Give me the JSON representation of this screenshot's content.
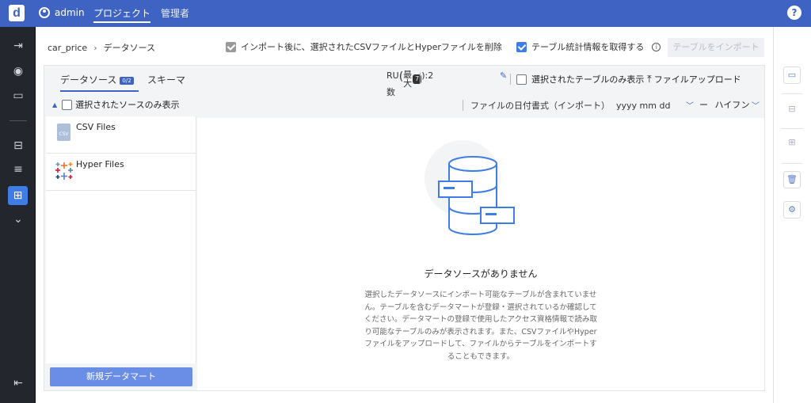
{
  "topbar": {
    "logo": "d",
    "user": "admin",
    "nav_active": "プロジェクト",
    "nav_admin": "管理者",
    "help": "?"
  },
  "breadcrumb": {
    "project": "car_price",
    "current": "データソース"
  },
  "options": {
    "delete_after_import": "インポート後に、選択されたCSVファイルとHyperファイルを削除",
    "get_stats": "テーブル統計情報を取得する",
    "import_button": "テーブルをインポート"
  },
  "tabs": {
    "datasource": "データソース",
    "badge": "0/2",
    "schema": "スキーマ"
  },
  "source_filter": "選択されたソースのみ表示",
  "sources": [
    {
      "name": "CSV Files",
      "icon": "csv-icon"
    },
    {
      "name": "Hyper Files",
      "icon": "tableau-icon"
    }
  ],
  "new_datamart": "新規データマート",
  "toolbar": {
    "ru_line1": "RU",
    "ru_line2": "数",
    "max_label": "最大",
    "max_badge": "7",
    "max_value": "):2",
    "paren": "(",
    "only_selected": "選択されたテーブルのみ表示",
    "upload": "ファイルアップロード",
    "date_format_label": "ファイルの日付書式（インポート）",
    "date_format_value": "yyyy mm dd",
    "separator": "ハイフン"
  },
  "empty": {
    "title": "データソースがありません",
    "desc": "選択したデータソースにインポート可能なテーブルが含まれていません。テーブルを含むデータマートが登録・選択されているか確認してください。データマートの登録で使用したアクセス資格情報で読み取り可能なテーブルのみが表示されます。また、CSVファイルやHyperファイルをアップロードして、ファイルからテーブルをインポートすることもできます。"
  }
}
